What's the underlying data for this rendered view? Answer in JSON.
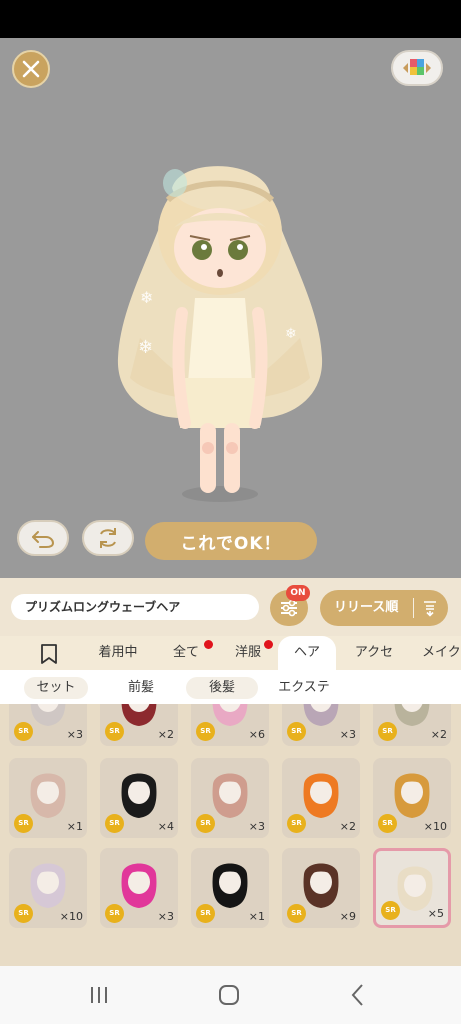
{
  "buttons": {
    "ok_label": "これでOK！"
  },
  "search": {
    "item_name": "プリズムロングウェーブヘア",
    "filter_badge": "ON",
    "sort_label": "リリース順"
  },
  "tabs": [
    {
      "label": "着用中"
    },
    {
      "label": "全て"
    },
    {
      "label": "洋服"
    },
    {
      "label": "ヘア"
    },
    {
      "label": "アクセ"
    },
    {
      "label": "メイク"
    }
  ],
  "subtabs": [
    {
      "label": "セット"
    },
    {
      "label": "前髪"
    },
    {
      "label": "後髪"
    },
    {
      "label": "エクステ"
    }
  ],
  "items": [
    {
      "rarity": "SR",
      "count": "×3",
      "color": "#cfc7c4"
    },
    {
      "rarity": "SR",
      "count": "×2",
      "color": "#8c2a2e"
    },
    {
      "rarity": "SR",
      "count": "×6",
      "color": "#e9a9c4"
    },
    {
      "rarity": "SR",
      "count": "×3",
      "color": "#b9a6b6"
    },
    {
      "rarity": "SR",
      "count": "×2",
      "color": "#b9b39c"
    },
    {
      "rarity": "SR",
      "count": "×1",
      "color": "#d7b8aa"
    },
    {
      "rarity": "SR",
      "count": "×4",
      "color": "#1b1b1b"
    },
    {
      "rarity": "SR",
      "count": "×3",
      "color": "#cf9d8e"
    },
    {
      "rarity": "SR",
      "count": "×2",
      "color": "#ee7a22"
    },
    {
      "rarity": "SR",
      "count": "×10",
      "color": "#d79a3c"
    },
    {
      "rarity": "SR",
      "count": "×10",
      "color": "#d6c8d6"
    },
    {
      "rarity": "SR",
      "count": "×3",
      "color": "#e1379a"
    },
    {
      "rarity": "SR",
      "count": "×1",
      "color": "#151515"
    },
    {
      "rarity": "SR",
      "count": "×9",
      "color": "#5a3326"
    },
    {
      "rarity": "SR",
      "count": "×5",
      "color": "#e9ddc5"
    }
  ],
  "colors": {
    "accent": "#d2ae6e",
    "stage_bg": "#9a9a9a",
    "badge_red": "#e84c3d"
  }
}
